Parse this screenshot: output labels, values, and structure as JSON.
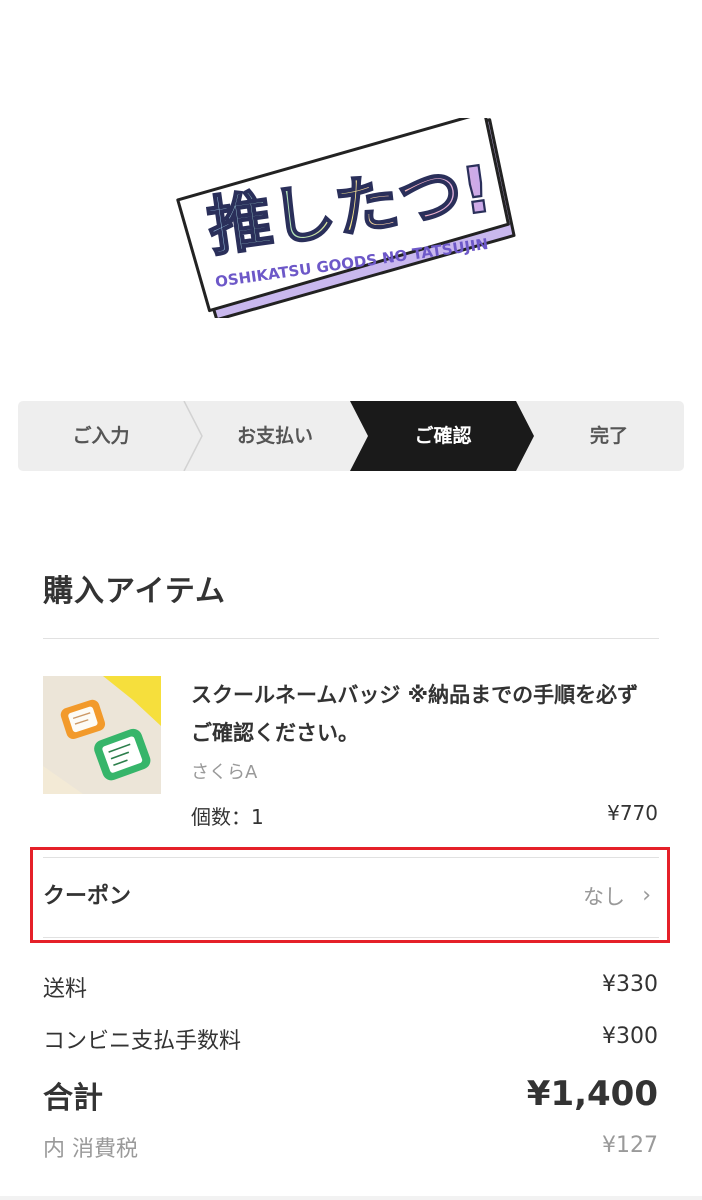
{
  "logo": {
    "title": "推したつ!",
    "subtitle": "OSHIKATSU GOODS NO TATSUJIN"
  },
  "steps": [
    {
      "label": "ご入力",
      "active": false
    },
    {
      "label": "お支払い",
      "active": false
    },
    {
      "label": "ご確認",
      "active": true
    },
    {
      "label": "完了",
      "active": false
    }
  ],
  "section_title": "購入アイテム",
  "item": {
    "name": "スクールネームバッジ ※納品までの手順を必ずご確認ください。",
    "variant": "さくらA",
    "quantity_label": "個数：1",
    "price": "¥770"
  },
  "coupon": {
    "label": "クーポン",
    "value": "なし",
    "chevron": "›"
  },
  "summary": {
    "shipping_label": "送料",
    "shipping_value": "¥330",
    "fee_label": "コンビニ支払手数料",
    "fee_value": "¥300",
    "total_label": "合計",
    "total_value": "¥1,400",
    "tax_label": "内 消費税",
    "tax_value": "¥127"
  },
  "colors": {
    "highlight": "#e52029",
    "active_step": "#1a1a1a",
    "step_bg": "#eeeeee"
  }
}
